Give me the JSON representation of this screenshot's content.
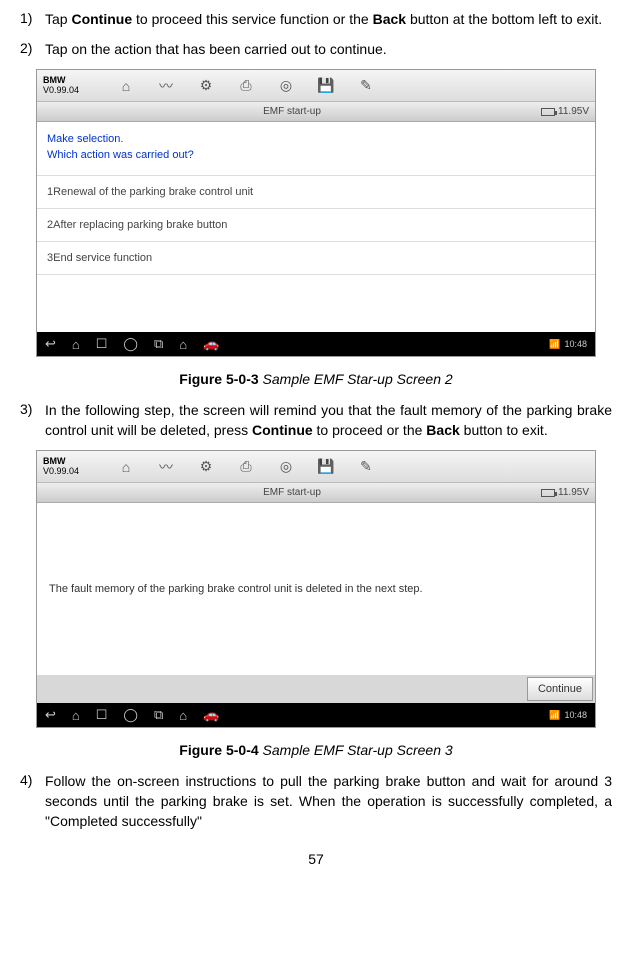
{
  "steps": {
    "s1": {
      "num": "1)",
      "text_pre": "Tap ",
      "bold1": "Continue",
      "text_mid": " to proceed this service function or the ",
      "bold2": "Back",
      "text_post": " button at the bottom left to exit."
    },
    "s2": {
      "num": "2)",
      "text": "Tap on the action that has been carried out to continue."
    },
    "s3": {
      "num": "3)",
      "text_pre": "In the following step, the screen will remind you that the fault memory of the parking brake control unit will be deleted, press ",
      "bold1": "Continue",
      "text_mid": " to proceed or the ",
      "bold2": "Back",
      "text_post": " button to exit."
    },
    "s4": {
      "num": "4)",
      "text": "Follow the on-screen instructions to pull the parking brake button and wait for around 3 seconds until the parking brake is set. When the operation is successfully completed, a \"Completed successfully\""
    }
  },
  "fig1": {
    "label": "Figure 5-0-3",
    "title": " Sample EMF Star-up Screen 2",
    "brand": "BMW",
    "version": "V0.99.04",
    "subheader": "EMF start-up",
    "voltage": "11.95V",
    "prompt_line1": "Make selection.",
    "prompt_line2": "Which action was carried out?",
    "items": {
      "i1": "1Renewal of the parking brake control unit",
      "i2": "2After replacing parking brake button",
      "i3": "3End service function"
    },
    "time": "10:48"
  },
  "fig2": {
    "label": "Figure 5-0-4",
    "title": " Sample EMF Star-up Screen 3",
    "brand": "BMW",
    "version": "V0.99.04",
    "subheader": "EMF start-up",
    "voltage": "11.95V",
    "msg": "The fault memory of the parking brake control unit is deleted in the next step.",
    "continue_btn": "Continue",
    "time": "10:48"
  },
  "page_number": "57"
}
